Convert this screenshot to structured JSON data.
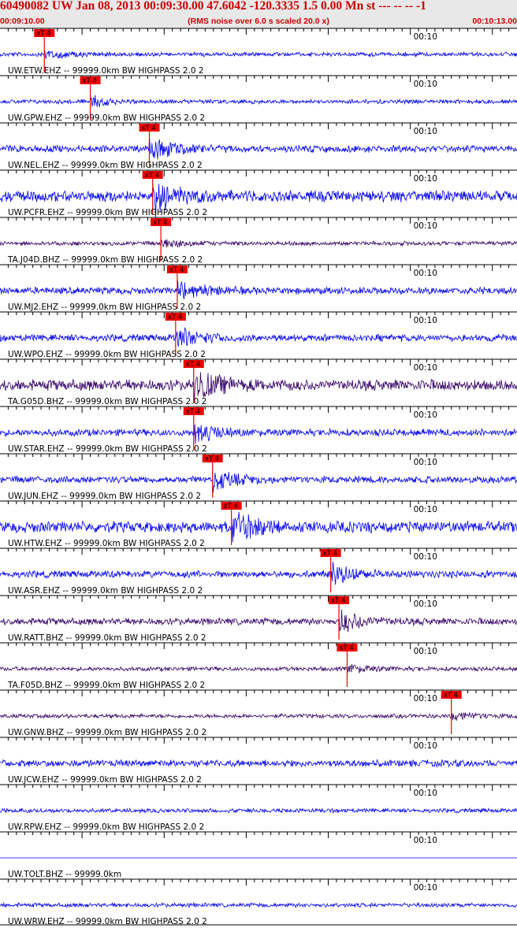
{
  "header": {
    "title": "60490082 UW Jan 08, 2013 00:09:30.00   47.6042 -120.3335  1.5 0.00 Mn st --- -- --  -1",
    "start_time": "00:09:10.00",
    "note": "(RMS noise over 6.0 s scaled 20.0 x)",
    "end_time": "00:10:13.00"
  },
  "chart_data": {
    "type": "line",
    "title": "60490082 UW Jan 08, 2013 00:09:30.00",
    "x_range": [
      "00:09:10.00",
      "00:10:13.00"
    ],
    "time_mark": "00:10",
    "time_mark_seconds": 50,
    "duration_seconds": 63,
    "pick_label": "xT 4",
    "colors": {
      "blue": "#0000ee",
      "purple": "#330066",
      "pick": "#ee0000",
      "header": "#cc0000"
    },
    "traces": [
      {
        "label": "UW.ETW.EHZ -- 99999.0km BW  HIGHPASS  2.0  2",
        "pick_seconds": 5.4,
        "amplitude": "low",
        "color": "blue"
      },
      {
        "label": "UW.GPW.EHZ -- 99999.0km BW  HIGHPASS  2.0  2",
        "pick_seconds": 11.0,
        "amplitude": "low",
        "color": "blue"
      },
      {
        "label": "UW.NEL.EHZ -- 99999.0km BW  HIGHPASS  2.0  2",
        "pick_seconds": 18.2,
        "amplitude": "medium",
        "color": "blue"
      },
      {
        "label": "UW.PCFR.EHZ -- 99999.0km BW  HIGHPASS  2.0  2",
        "pick_seconds": 18.6,
        "amplitude": "high",
        "color": "blue"
      },
      {
        "label": "TA.J04D.BHZ -- 99999.0km BW  HIGHPASS  2.0  2",
        "pick_seconds": 19.6,
        "amplitude": "low",
        "color": "purple"
      },
      {
        "label": "UW.MJ2.EHZ -- 99999.0km BW  HIGHPASS  2.0  2",
        "pick_seconds": 21.6,
        "amplitude": "medium",
        "color": "blue"
      },
      {
        "label": "UW.WPO.EHZ -- 99999.0km BW  HIGHPASS  2.0  2",
        "pick_seconds": 21.4,
        "amplitude": "medium",
        "color": "blue"
      },
      {
        "label": "TA.G05D.BHZ -- 99999.0km BW  HIGHPASS  2.0  2",
        "pick_seconds": 23.6,
        "amplitude": "high",
        "color": "purple"
      },
      {
        "label": "UW.STAR.EHZ -- 99999.0km BW  HIGHPASS  2.0  2",
        "pick_seconds": 23.6,
        "amplitude": "medium",
        "color": "blue"
      },
      {
        "label": "UW.JUN.EHZ -- 99999.0km BW  HIGHPASS  2.0  2",
        "pick_seconds": 25.9,
        "amplitude": "medium",
        "color": "blue"
      },
      {
        "label": "UW.HTW.EHZ -- 99999.0km BW  HIGHPASS  2.0  2",
        "pick_seconds": 28.2,
        "amplitude": "high",
        "color": "blue"
      },
      {
        "label": "UW.ASR.EHZ -- 99999.0km BW  HIGHPASS  2.0  2",
        "pick_seconds": 40.3,
        "amplitude": "medium",
        "color": "blue"
      },
      {
        "label": "UW.RATT.BHZ -- 99999.0km BW  HIGHPASS  2.0  2",
        "pick_seconds": 41.3,
        "amplitude": "medium",
        "color": "purple"
      },
      {
        "label": "TA.F05D.BHZ -- 99999.0km BW  HIGHPASS  2.0  2",
        "pick_seconds": 42.3,
        "amplitude": "low",
        "color": "purple"
      },
      {
        "label": "UW.GNW.BHZ -- 99999.0km BW  HIGHPASS  2.0  2",
        "pick_seconds": 55.0,
        "amplitude": "low",
        "color": "purple"
      },
      {
        "label": "UW.JCW.EHZ -- 99999.0km BW  HIGHPASS  2.0  2",
        "pick_seconds": null,
        "amplitude": "medium",
        "color": "blue"
      },
      {
        "label": "UW.RPW.EHZ -- 99999.0km BW  HIGHPASS  2.0  2",
        "pick_seconds": null,
        "amplitude": "low",
        "color": "blue"
      },
      {
        "label": "UW.TOLT.BHZ -- 99999.0km",
        "pick_seconds": null,
        "amplitude": "flat",
        "color": "blue"
      },
      {
        "label": "UW.WRW.EHZ -- 99999.0km BW  HIGHPASS  2.0  2",
        "pick_seconds": null,
        "amplitude": "low",
        "color": "blue"
      }
    ]
  }
}
